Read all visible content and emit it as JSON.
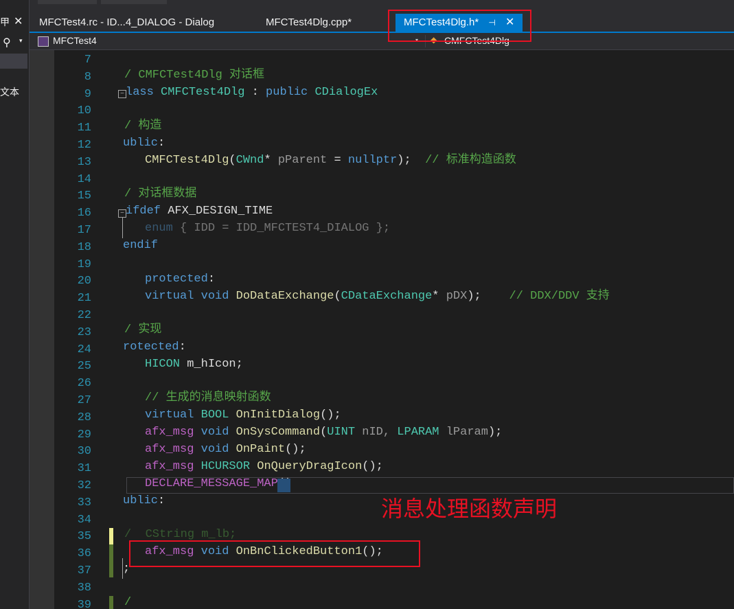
{
  "left_panel": {
    "top_glyph": "甲",
    "close_glyph": "✕",
    "search_glyph": "⚲",
    "caret_glyph": "▾",
    "text_label": "文本"
  },
  "tabs": [
    {
      "label": "MFCTest4.rc - ID...4_DIALOG - Dialog",
      "active": false
    },
    {
      "label": "MFCTest4Dlg.cpp*",
      "active": false
    },
    {
      "label": "MFCTest4Dlg.h*",
      "active": true,
      "pin_glyph": "⊣",
      "close_glyph": "✕"
    }
  ],
  "nav": {
    "project": "MFCTest4",
    "class_icon": "◆",
    "class_name": "CMFCTest4Dlg",
    "drop_caret": "▾"
  },
  "editor": {
    "line_numbers": [
      "7",
      "8",
      "9",
      "10",
      "11",
      "12",
      "13",
      "14",
      "15",
      "16",
      "17",
      "18",
      "19",
      "20",
      "21",
      "22",
      "23",
      "24",
      "25",
      "26",
      "27",
      "28",
      "29",
      "30",
      "31",
      "32",
      "33",
      "34",
      "35",
      "36",
      "37",
      "38",
      "39"
    ],
    "fold_glyph": "−"
  },
  "code": {
    "l8": {
      "c": "/ CMFCTest4Dlg 对话框"
    },
    "l9": {
      "k": "lass",
      "t": "CMFCTest4Dlg",
      "p": " : ",
      "k2": "public",
      "t2": "CDialogEx"
    },
    "l11": {
      "c": "/ 构造"
    },
    "l12": {
      "k": "ublic",
      "p": ":"
    },
    "l13": {
      "f": "CMFCTest4Dlg",
      "p1": "(",
      "t": "CWnd",
      "p2": "* ",
      "pm": "pParent",
      "p3": " = ",
      "k": "nullptr",
      "p4": ");  ",
      "c": "// 标准构造函数"
    },
    "l15": {
      "c": "/ 对话框数据"
    },
    "l16": {
      "k": "ifdef ",
      "m": "AFX_DESIGN_TIME"
    },
    "l17": {
      "k": "enum",
      "p1": " { ",
      "t": "IDD",
      "p2": " = ",
      "m": "IDD_MFCTEST4_DIALOG",
      "p3": " };"
    },
    "l18": {
      "k": "endif"
    },
    "l20": {
      "k": "protected",
      "p": ":"
    },
    "l21": {
      "k": "virtual",
      "k2": "void",
      "f": "DoDataExchange",
      "p1": "(",
      "t": "CDataExchange",
      "p2": "* ",
      "pm": "pDX",
      "p3": ");    ",
      "c": "// DDX/DDV 支持"
    },
    "l23": {
      "c": "/ 实现"
    },
    "l24": {
      "k": "rotected",
      "p": ":"
    },
    "l25": {
      "t": "HICON",
      "v": " m_hIcon;"
    },
    "l27": {
      "c": "// 生成的消息映射函数"
    },
    "l28": {
      "k": "virtual",
      "t": "BOOL",
      "f": "OnInitDialog",
      "p": "();"
    },
    "l29": {
      "m": "afx_msg",
      "k": "void",
      "f": "OnSysCommand",
      "p1": "(",
      "t": "UINT",
      "pm": " nID, ",
      "t2": "LPARAM",
      "pm2": " lParam",
      "p2": ");"
    },
    "l30": {
      "m": "afx_msg",
      "k": "void",
      "f": "OnPaint",
      "p": "();"
    },
    "l31": {
      "m": "afx_msg",
      "t": "HCURSOR",
      "f": "OnQueryDragIcon",
      "p": "();"
    },
    "l32": {
      "m": "DECLARE_MESSAGE_MAP",
      "p": "()"
    },
    "l33": {
      "k": "ublic",
      "p": ":"
    },
    "l35": {
      "c": "/  CString m_lb;"
    },
    "l36": {
      "m": "afx_msg",
      "k": "void",
      "f": "OnBnClickedButton1",
      "p": "();"
    },
    "l37": {
      "p": ";"
    },
    "l39": {
      "c": "/"
    }
  },
  "annotation": "消息处理函数声明",
  "colors": {
    "keyword": "#569cd6",
    "type": "#4ec9b0",
    "function": "#dcdcaa",
    "comment": "#57a64a",
    "macro": "#bd63c5",
    "line_number": "#2b91af",
    "accent": "#007acc",
    "annotation": "#e81123"
  }
}
